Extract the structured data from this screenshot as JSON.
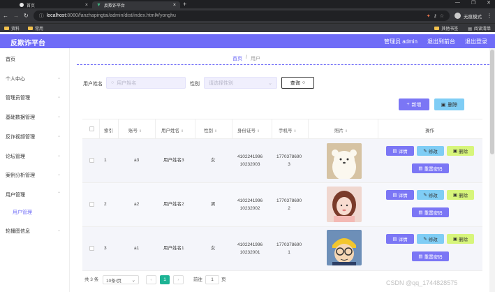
{
  "browser": {
    "tab1": "首页",
    "tab2": "反欺诈平台",
    "tab_new": "+",
    "win_min": "—",
    "win_max": "❐",
    "win_close": "✕",
    "url_host": "localhost",
    "url_rest": ":8080/fanzhapingtai/admin/dist/index.html#/yonghu",
    "incognito": "无痕模式",
    "bookmarks": [
      "资料",
      "常用"
    ],
    "bookmarks_right": [
      "其他书签",
      "阅读清单"
    ]
  },
  "header": {
    "brand": "反欺诈平台",
    "user": "管理员 admin",
    "to_front": "退出到前台",
    "logout": "退出登录"
  },
  "sidebar": {
    "items": [
      "首页",
      "个人中心",
      "管理员管理",
      "基础数据管理",
      "反诈视频管理",
      "论坛管理",
      "案例分析管理",
      "用户管理",
      "用户管理",
      "轮播图信息"
    ]
  },
  "breadcrumb": {
    "home": "首页",
    "sep": "/",
    "current": "用户"
  },
  "search": {
    "name_label": "用户姓名",
    "name_placeholder": "用户姓名",
    "gender_label": "性别",
    "gender_placeholder": "请选择性别",
    "query": "查询"
  },
  "actions": {
    "add": "新增",
    "delete": "删除"
  },
  "table": {
    "headers": [
      "索引",
      "账号",
      "用户姓名",
      "性别",
      "身份证号",
      "手机号",
      "照片",
      "操作"
    ],
    "rows": [
      {
        "index": "1",
        "account": "a3",
        "name": "用户姓名3",
        "gender": "女",
        "id_line1": "4102241996",
        "id_line2": "10232003",
        "phone_line1": "1770378690",
        "phone_line2": "3"
      },
      {
        "index": "2",
        "account": "a2",
        "name": "用户姓名2",
        "gender": "男",
        "id_line1": "4102241996",
        "id_line2": "10232002",
        "phone_line1": "1770378690",
        "phone_line2": "2"
      },
      {
        "index": "3",
        "account": "a1",
        "name": "用户姓名1",
        "gender": "女",
        "id_line1": "4102241996",
        "id_line2": "10232001",
        "phone_line1": "1770378690",
        "phone_line2": "1"
      }
    ],
    "ops": {
      "detail": "详情",
      "edit": "修改",
      "delete": "删除",
      "reset": "重置密码"
    }
  },
  "pager": {
    "total": "共 3 条",
    "size": "10条/页",
    "current": "1",
    "goto_label": "前往",
    "goto_value": "1",
    "goto_unit": "页"
  },
  "watermark": "CSDN @qq_1744828575",
  "colors": {
    "accent": "#6f6cf7",
    "page_active": "#1cb394",
    "edit": "#7fcdf5",
    "delete": "#d7f57b"
  }
}
